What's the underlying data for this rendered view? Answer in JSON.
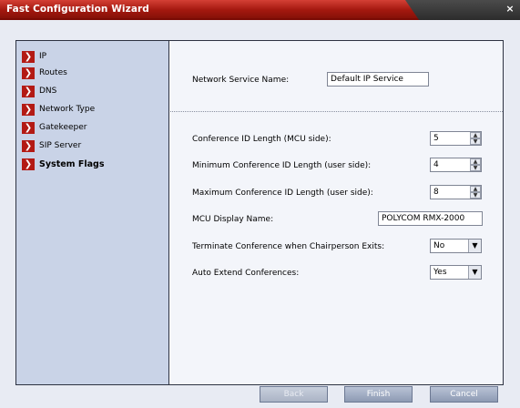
{
  "window": {
    "title": "Fast Configuration Wizard",
    "close_label": "×"
  },
  "sidebar": {
    "items": [
      {
        "label": "IP",
        "icon": "arrow-right-icon"
      },
      {
        "label": "Routes",
        "icon": "arrow-right-icon"
      },
      {
        "label": "DNS",
        "icon": "arrow-right-icon"
      },
      {
        "label": "Network Type",
        "icon": "arrow-right-icon"
      },
      {
        "label": "Gatekeeper",
        "icon": "arrow-right-icon"
      },
      {
        "label": "SIP Server",
        "icon": "arrow-right-icon"
      },
      {
        "label": "System Flags",
        "icon": "arrow-right-icon",
        "active": true
      }
    ]
  },
  "form": {
    "network_service_name": {
      "label": "Network Service Name:",
      "value": "Default IP Service"
    },
    "conf_id_length": {
      "label": "Conference ID Length (MCU side):",
      "value": "5"
    },
    "min_conf_id_length": {
      "label": "Minimum Conference ID Length (user side):",
      "value": "4"
    },
    "max_conf_id_length": {
      "label": "Maximum Conference ID Length (user side):",
      "value": "8"
    },
    "mcu_display_name": {
      "label": "MCU Display Name:",
      "value": "POLYCOM RMX-2000"
    },
    "terminate_on_chair_exit": {
      "label": "Terminate Conference when Chairperson Exits:",
      "value": "No"
    },
    "auto_extend": {
      "label": "Auto Extend Conferences:",
      "value": "Yes"
    }
  },
  "buttons": {
    "back": "Back",
    "finish": "Finish",
    "cancel": "Cancel"
  },
  "colors": {
    "title_red": "#a4180f",
    "sidebar_bg": "#c9d3e7",
    "arrow_icon_red": "#b31a14"
  }
}
